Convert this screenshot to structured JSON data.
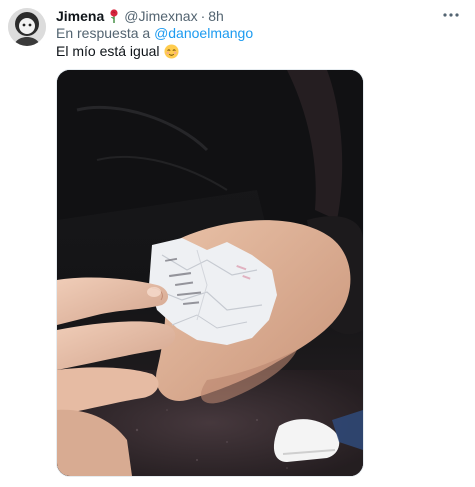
{
  "tweet": {
    "display_name": "Jimena",
    "name_emoji": "rose-icon",
    "handle": "@Jimexnax",
    "separator": "·",
    "time": "8h",
    "reply_prefix": "En respuesta a ",
    "reply_to": "@danoelmango",
    "text": "El mío está igual",
    "text_emoji": "relieved-face-icon",
    "more_icon": "more-horizontal-icon"
  },
  "colors": {
    "text_primary": "#0f1419",
    "text_secondary": "#536471",
    "link": "#1d9bf0"
  }
}
